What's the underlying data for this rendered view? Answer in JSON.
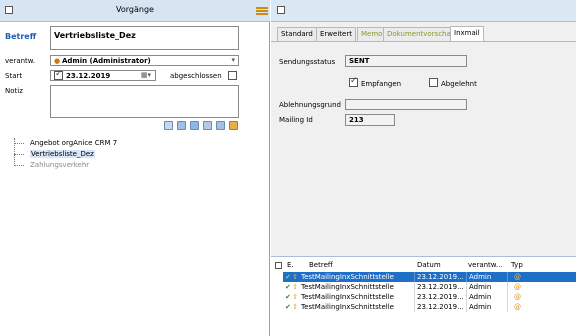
{
  "left": {
    "title": "Vorgänge",
    "betreff_label": "Betreff",
    "betreff_value": "Vertriebsliste_Dez",
    "verantw_label": "verantw.",
    "verantw_value": "Admin (Administrator)",
    "start_label": "Start",
    "start_value": "23.12.2019",
    "abgeschlossen_label": "abgeschlossen",
    "notiz_label": "Notiz",
    "tree": [
      {
        "label": "Angebot orgAnice CRM 7",
        "state": "normal"
      },
      {
        "label": "Vertriebsliste_Dez",
        "state": "selected"
      },
      {
        "label": "Zahlungsverkehr",
        "state": "disabled"
      }
    ]
  },
  "right": {
    "tabs": [
      {
        "label": "Standard",
        "color": "#000000",
        "active": false
      },
      {
        "label": "Erweitert",
        "color": "#000000",
        "active": false
      },
      {
        "label": "Memo",
        "color": "#8a9a2a",
        "active": false
      },
      {
        "label": "Dokumentvorschau",
        "color": "#8a9a2a",
        "active": false
      },
      {
        "label": "Inxmail",
        "color": "#000000",
        "active": true
      }
    ],
    "sendungsstatus_label": "Sendungsstatus",
    "sendungsstatus_value": "SENT",
    "empfangen_label": "Empfangen",
    "abgelehnt_label": "Abgelehnt",
    "ablehnungsgrund_label": "Ablehnungsgrund",
    "mailing_id_label": "Mailing Id",
    "mailing_id_value": "213",
    "grid": {
      "headers": [
        "E.",
        "Betreff",
        "Datum",
        "verantw...",
        "Typ"
      ],
      "rows": [
        {
          "betreff": "TestMailingInxSchnittstelle",
          "datum": "23.12.2019...",
          "verantw": "Admin",
          "selected": true
        },
        {
          "betreff": "TestMailingInxSchnittstelle",
          "datum": "23.12.2019...",
          "verantw": "Admin",
          "selected": false
        },
        {
          "betreff": "TestMailingInxSchnittstelle",
          "datum": "23.12.2019...",
          "verantw": "Admin",
          "selected": false
        },
        {
          "betreff": "TestMailingInxSchnittstelle",
          "datum": "23.12.2019...",
          "verantw": "Admin",
          "selected": false
        }
      ]
    }
  },
  "colors": {
    "accent_blue": "#1f6fc8",
    "header_bg": "#d7e4f2",
    "typ_orange": "#e08a14",
    "check_green": "#2e8b2e"
  },
  "icons": [
    "menu-icon",
    "user-icon",
    "calendar-icon",
    "check-icon",
    "arrow-icon",
    "typ-icon"
  ]
}
